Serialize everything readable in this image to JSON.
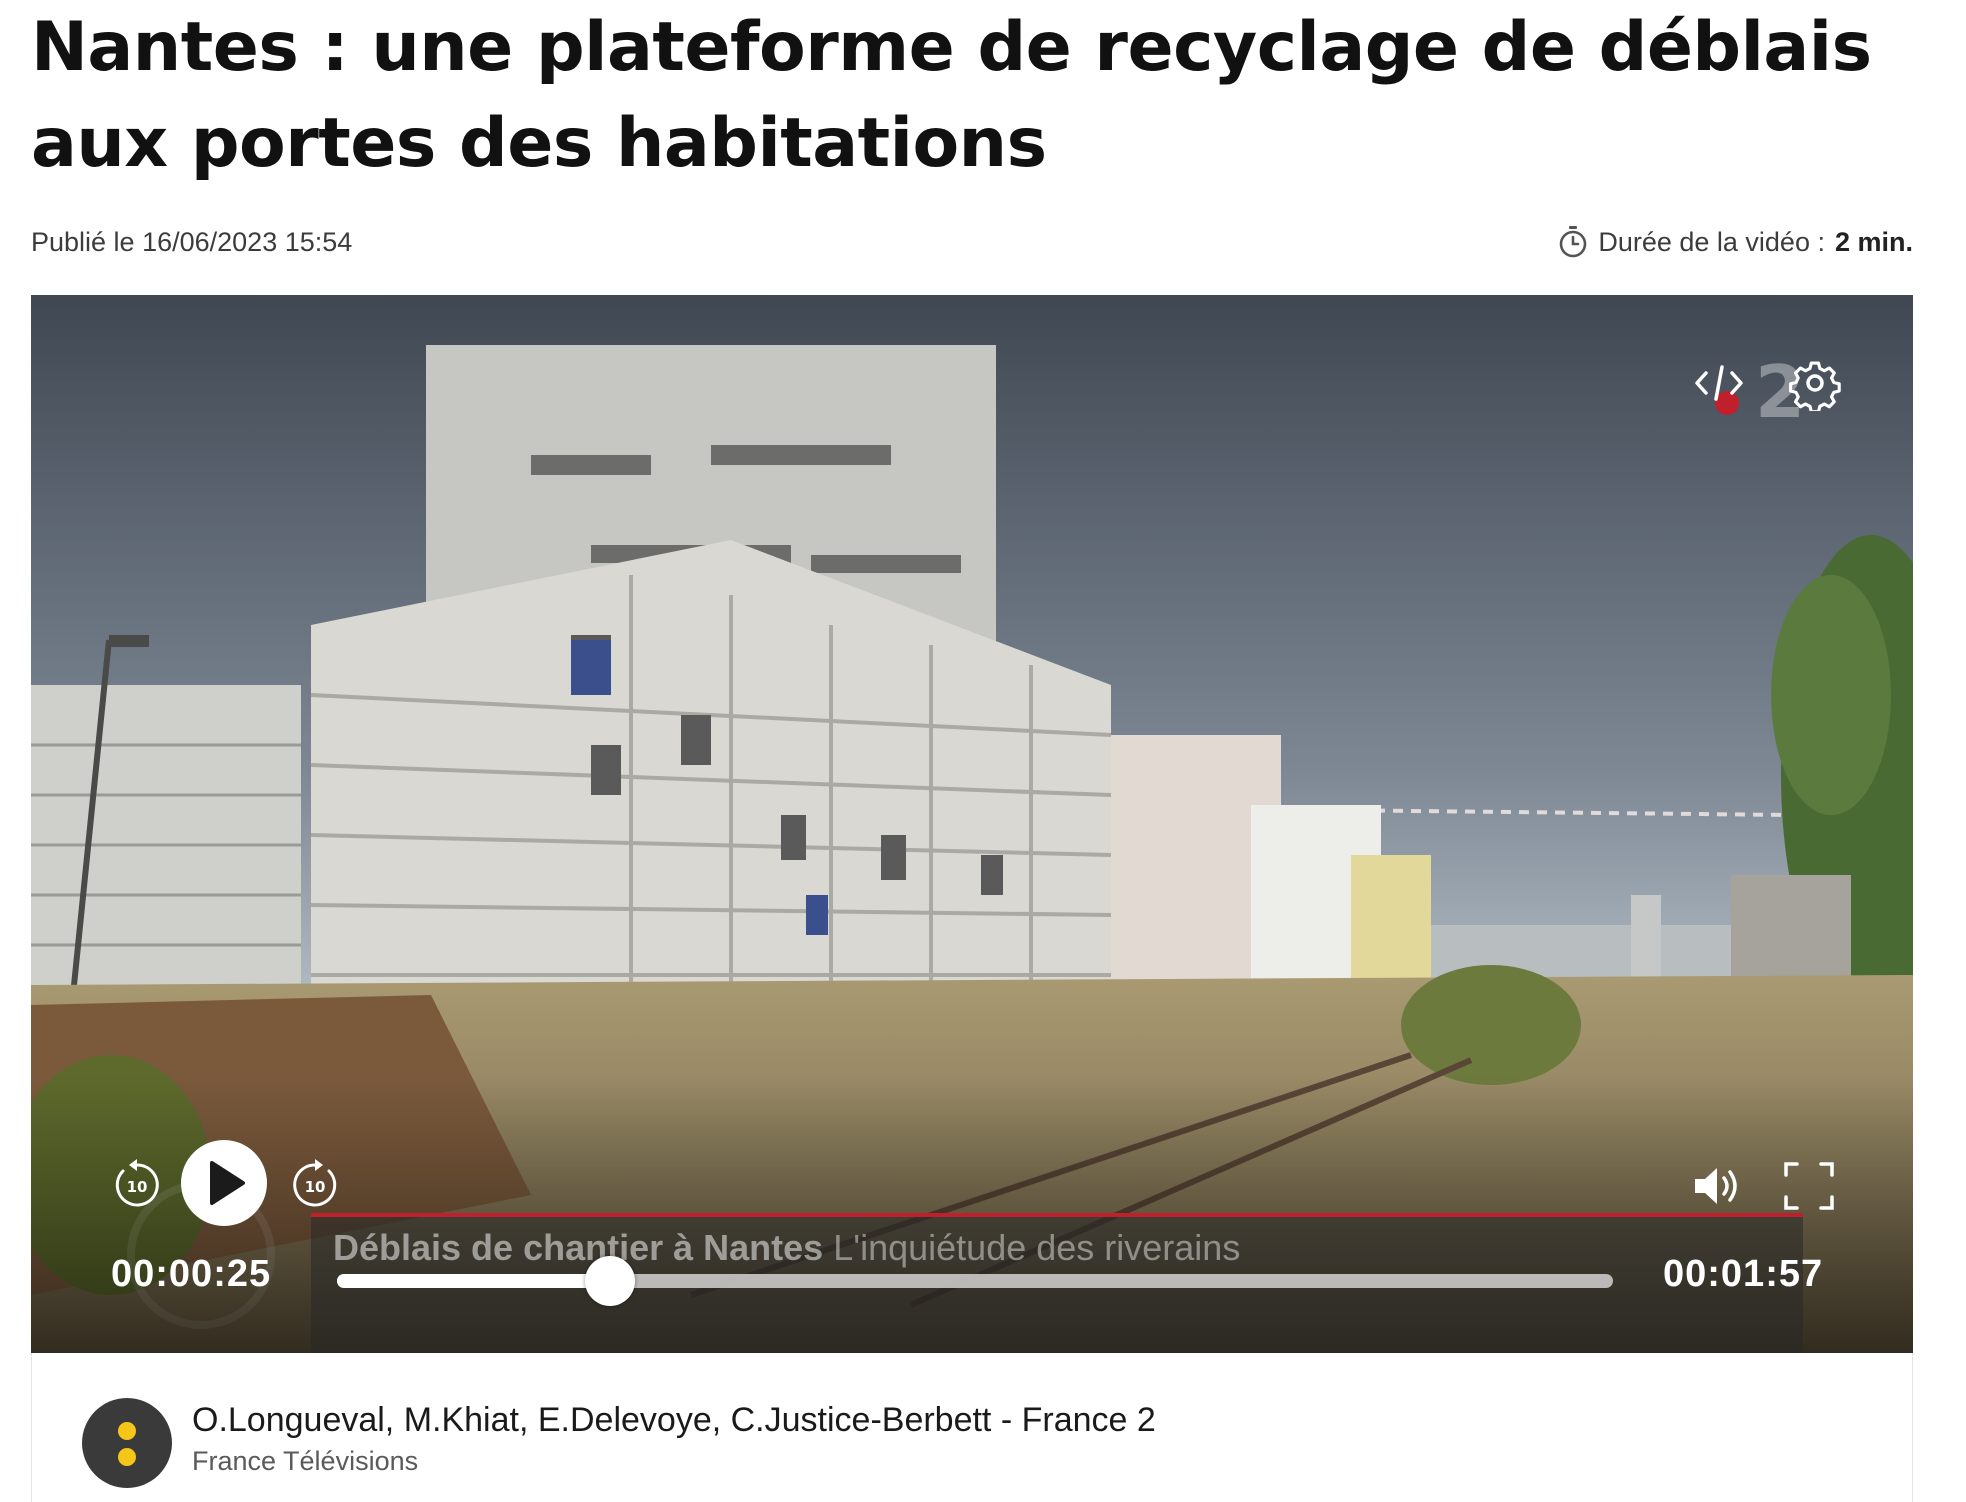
{
  "article": {
    "title": "Nantes : une plateforme de recyclage de déblais aux portes des habitations",
    "published": "Publié le 16/06/2023 15:54",
    "duration_label": "Durée de la vidéo : ",
    "duration_value": "2 min."
  },
  "player": {
    "current_time": "00:00:25",
    "total_time": "00:01:57",
    "progress_fraction": 0.2137,
    "caption_bold": "Déblais de chantier à Nantes",
    "caption_rest": " L'inquiétude des riverains",
    "rewind_seconds": "10",
    "forward_seconds": "10",
    "channel_logo": "2",
    "icons": {
      "embed": "code-embed-icon",
      "settings": "gear-icon",
      "rewind": "rewind-10-icon",
      "play": "play-icon",
      "forward": "forward-10-icon",
      "volume": "volume-icon",
      "fullscreen": "fullscreen-icon"
    }
  },
  "credits": {
    "names": "O.Longueval, M.Khiat, E.Delevoye, C.Justice-Berbett - France 2",
    "organization": "France Télévisions"
  },
  "colors": {
    "caption_accent": "#c0202b",
    "avatar_dot": "#f5c518"
  }
}
